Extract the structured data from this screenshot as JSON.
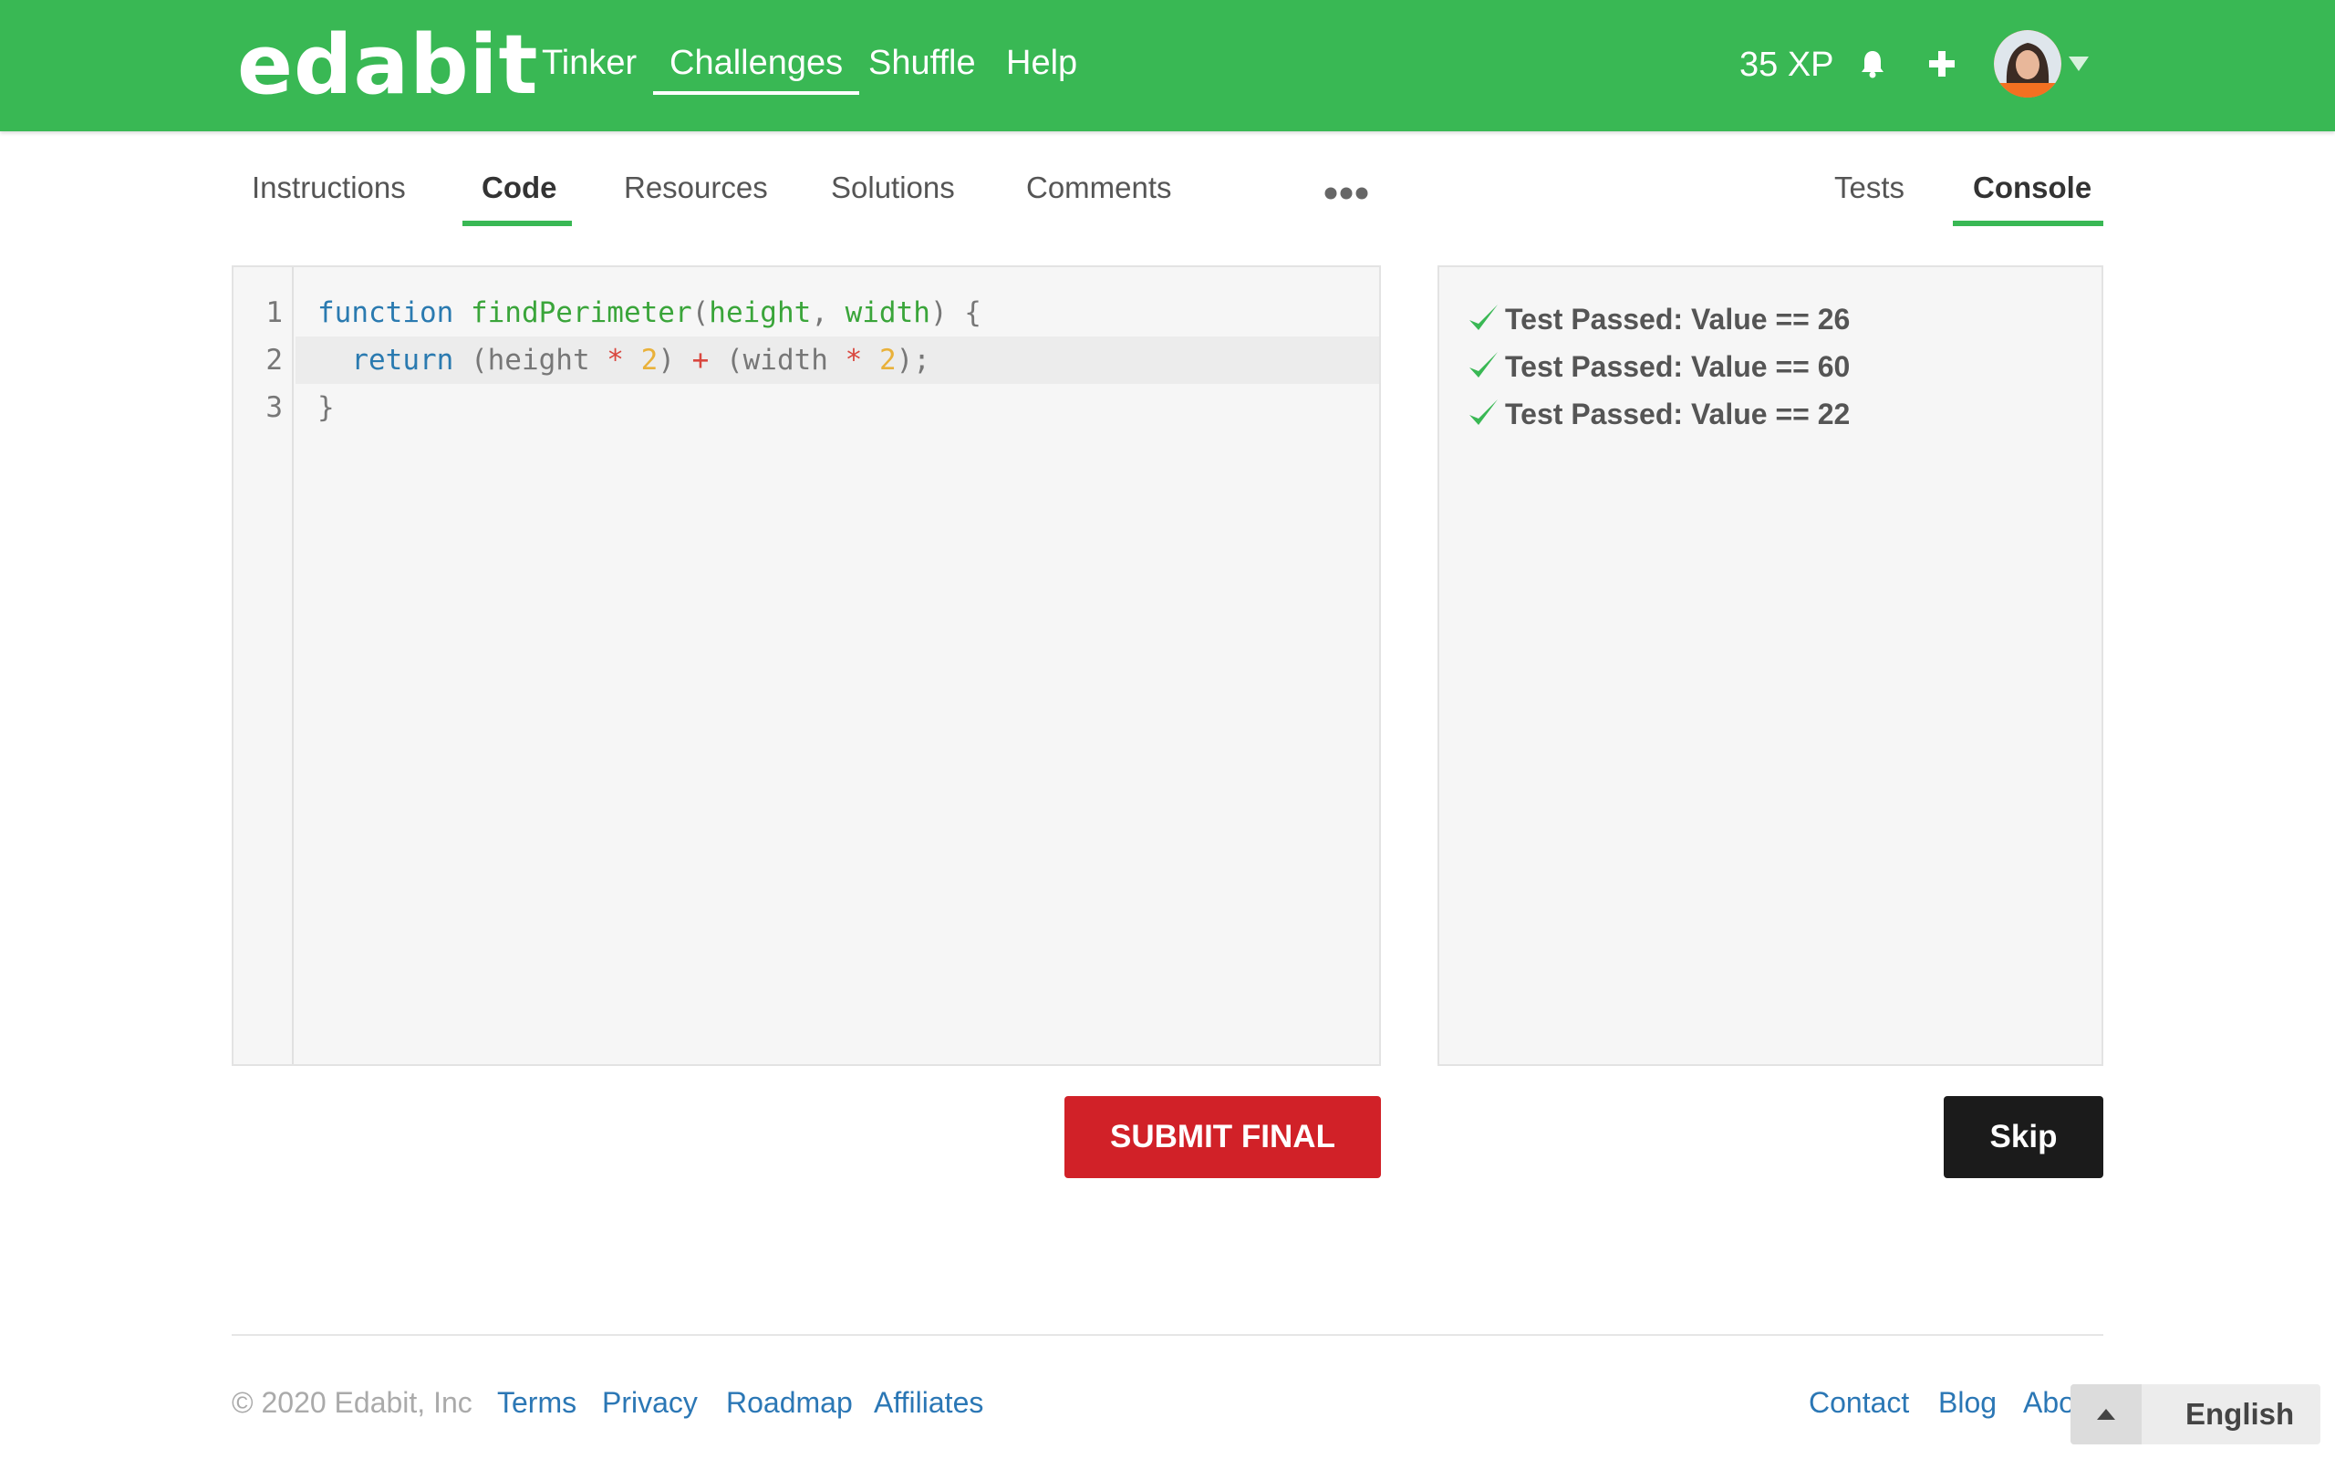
{
  "header": {
    "logo": "edabit",
    "nav": [
      {
        "label": "Tinker"
      },
      {
        "label": "Challenges",
        "active": true
      },
      {
        "label": "Shuffle"
      },
      {
        "label": "Help"
      }
    ],
    "xp": "35 XP",
    "icons": [
      "bell-icon",
      "plus-icon",
      "avatar",
      "chevron-down-icon"
    ]
  },
  "tabs": {
    "left": [
      {
        "label": "Instructions"
      },
      {
        "label": "Code",
        "active": true
      },
      {
        "label": "Resources"
      },
      {
        "label": "Solutions"
      },
      {
        "label": "Comments"
      }
    ],
    "right": [
      {
        "label": "Tests"
      },
      {
        "label": "Console",
        "active": true
      }
    ]
  },
  "editor": {
    "line_numbers": [
      "1",
      "2",
      "3"
    ],
    "lines": [
      "function findPerimeter(height, width) {",
      "  return (height * 2) + (width * 2);",
      "}"
    ],
    "active_line": 2
  },
  "console": {
    "results": [
      "Test Passed: Value == 26",
      "Test Passed: Value == 60",
      "Test Passed: Value == 22"
    ]
  },
  "buttons": {
    "submit": "SUBMIT FINAL",
    "skip": "Skip"
  },
  "footer": {
    "copyright": "© 2020 Edabit, Inc",
    "left_links": [
      "Terms",
      "Privacy",
      "Roadmap",
      "Affiliates"
    ],
    "right_links": [
      "Contact",
      "Blog",
      "About"
    ],
    "language": "English"
  },
  "colors": {
    "brand_green": "#39b854",
    "submit_red": "#d12128",
    "skip_black": "#1b1b1b",
    "link_blue": "#2b77b5"
  }
}
